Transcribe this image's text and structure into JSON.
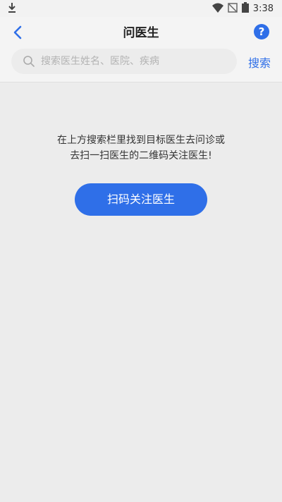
{
  "status_bar": {
    "time": "3:38",
    "icons": [
      "download-icon",
      "wifi-icon",
      "signal-off-icon",
      "battery-icon"
    ]
  },
  "header": {
    "title": "问医生",
    "back_icon": "chevron-left-icon",
    "help_label": "?"
  },
  "search": {
    "placeholder": "搜索医生姓名、医院、疾病",
    "value": "",
    "button_label": "搜索"
  },
  "main": {
    "hint_line1": "在上方搜索栏里找到目标医生去问诊或",
    "hint_line2": "去扫一扫医生的二维码关注医生!",
    "scan_button_label": "扫码关注医生"
  },
  "colors": {
    "accent": "#2f6fe8",
    "background": "#ececec"
  }
}
